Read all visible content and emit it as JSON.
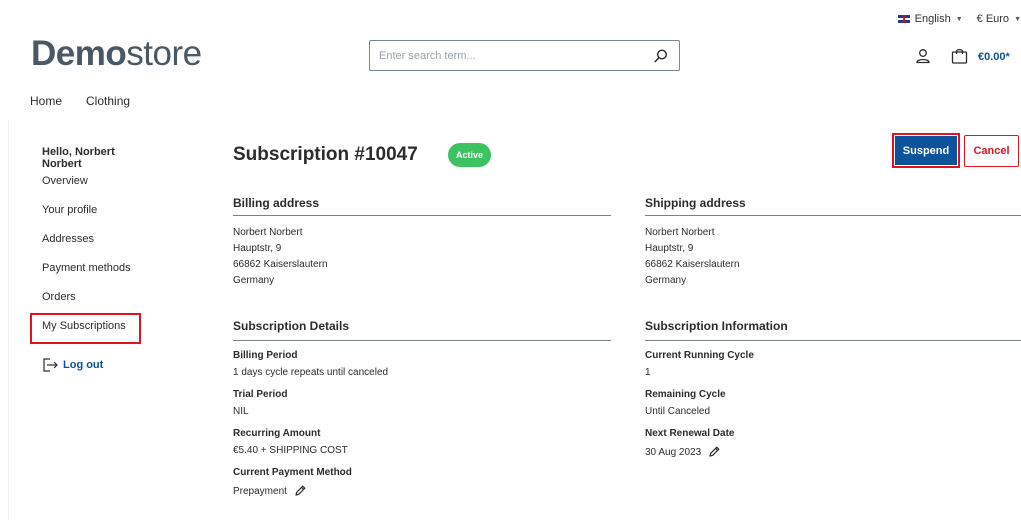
{
  "topbar": {
    "language": "English",
    "currency": "€ Euro"
  },
  "logo": {
    "bold": "Demo",
    "light": "store"
  },
  "search": {
    "placeholder": "Enter search term..."
  },
  "cart": {
    "total": "€0.00*"
  },
  "mainnav": [
    "Home",
    "Clothing"
  ],
  "sidebar": {
    "greeting": "Hello, Norbert Norbert",
    "items": [
      {
        "label": "Overview"
      },
      {
        "label": "Your profile"
      },
      {
        "label": "Addresses"
      },
      {
        "label": "Payment methods"
      },
      {
        "label": "Orders"
      },
      {
        "label": "My Subscriptions"
      }
    ],
    "logout": "Log out"
  },
  "subscription": {
    "title": "Subscription #10047",
    "status": "Active",
    "suspend_label": "Suspend",
    "cancel_label": "Cancel"
  },
  "billing_address": {
    "heading": "Billing address",
    "lines": [
      "Norbert Norbert",
      "Hauptstr, 9",
      "66862 Kaiserslautern",
      "Germany"
    ]
  },
  "shipping_address": {
    "heading": "Shipping address",
    "lines": [
      "Norbert Norbert",
      "Hauptstr, 9",
      "66862 Kaiserslautern",
      "Germany"
    ]
  },
  "details": {
    "heading": "Subscription Details",
    "billing_period_label": "Billing Period",
    "billing_period_value": "1 days cycle repeats until canceled",
    "trial_period_label": "Trial Period",
    "trial_period_value": "NIL",
    "recurring_amount_label": "Recurring Amount",
    "recurring_amount_value": "€5.40 + SHIPPING COST",
    "payment_method_label": "Current Payment Method",
    "payment_method_value": "Prepayment"
  },
  "information": {
    "heading": "Subscription Information",
    "running_cycle_label": "Current Running Cycle",
    "running_cycle_value": "1",
    "remaining_cycle_label": "Remaining Cycle",
    "remaining_cycle_value": "Until Canceled",
    "renewal_label": "Next Renewal Date",
    "renewal_value": "30 Aug 2023"
  },
  "colors": {
    "brand_blue": "#0b539b",
    "active_green": "#3cc261",
    "highlight_red": "#e0121f"
  }
}
